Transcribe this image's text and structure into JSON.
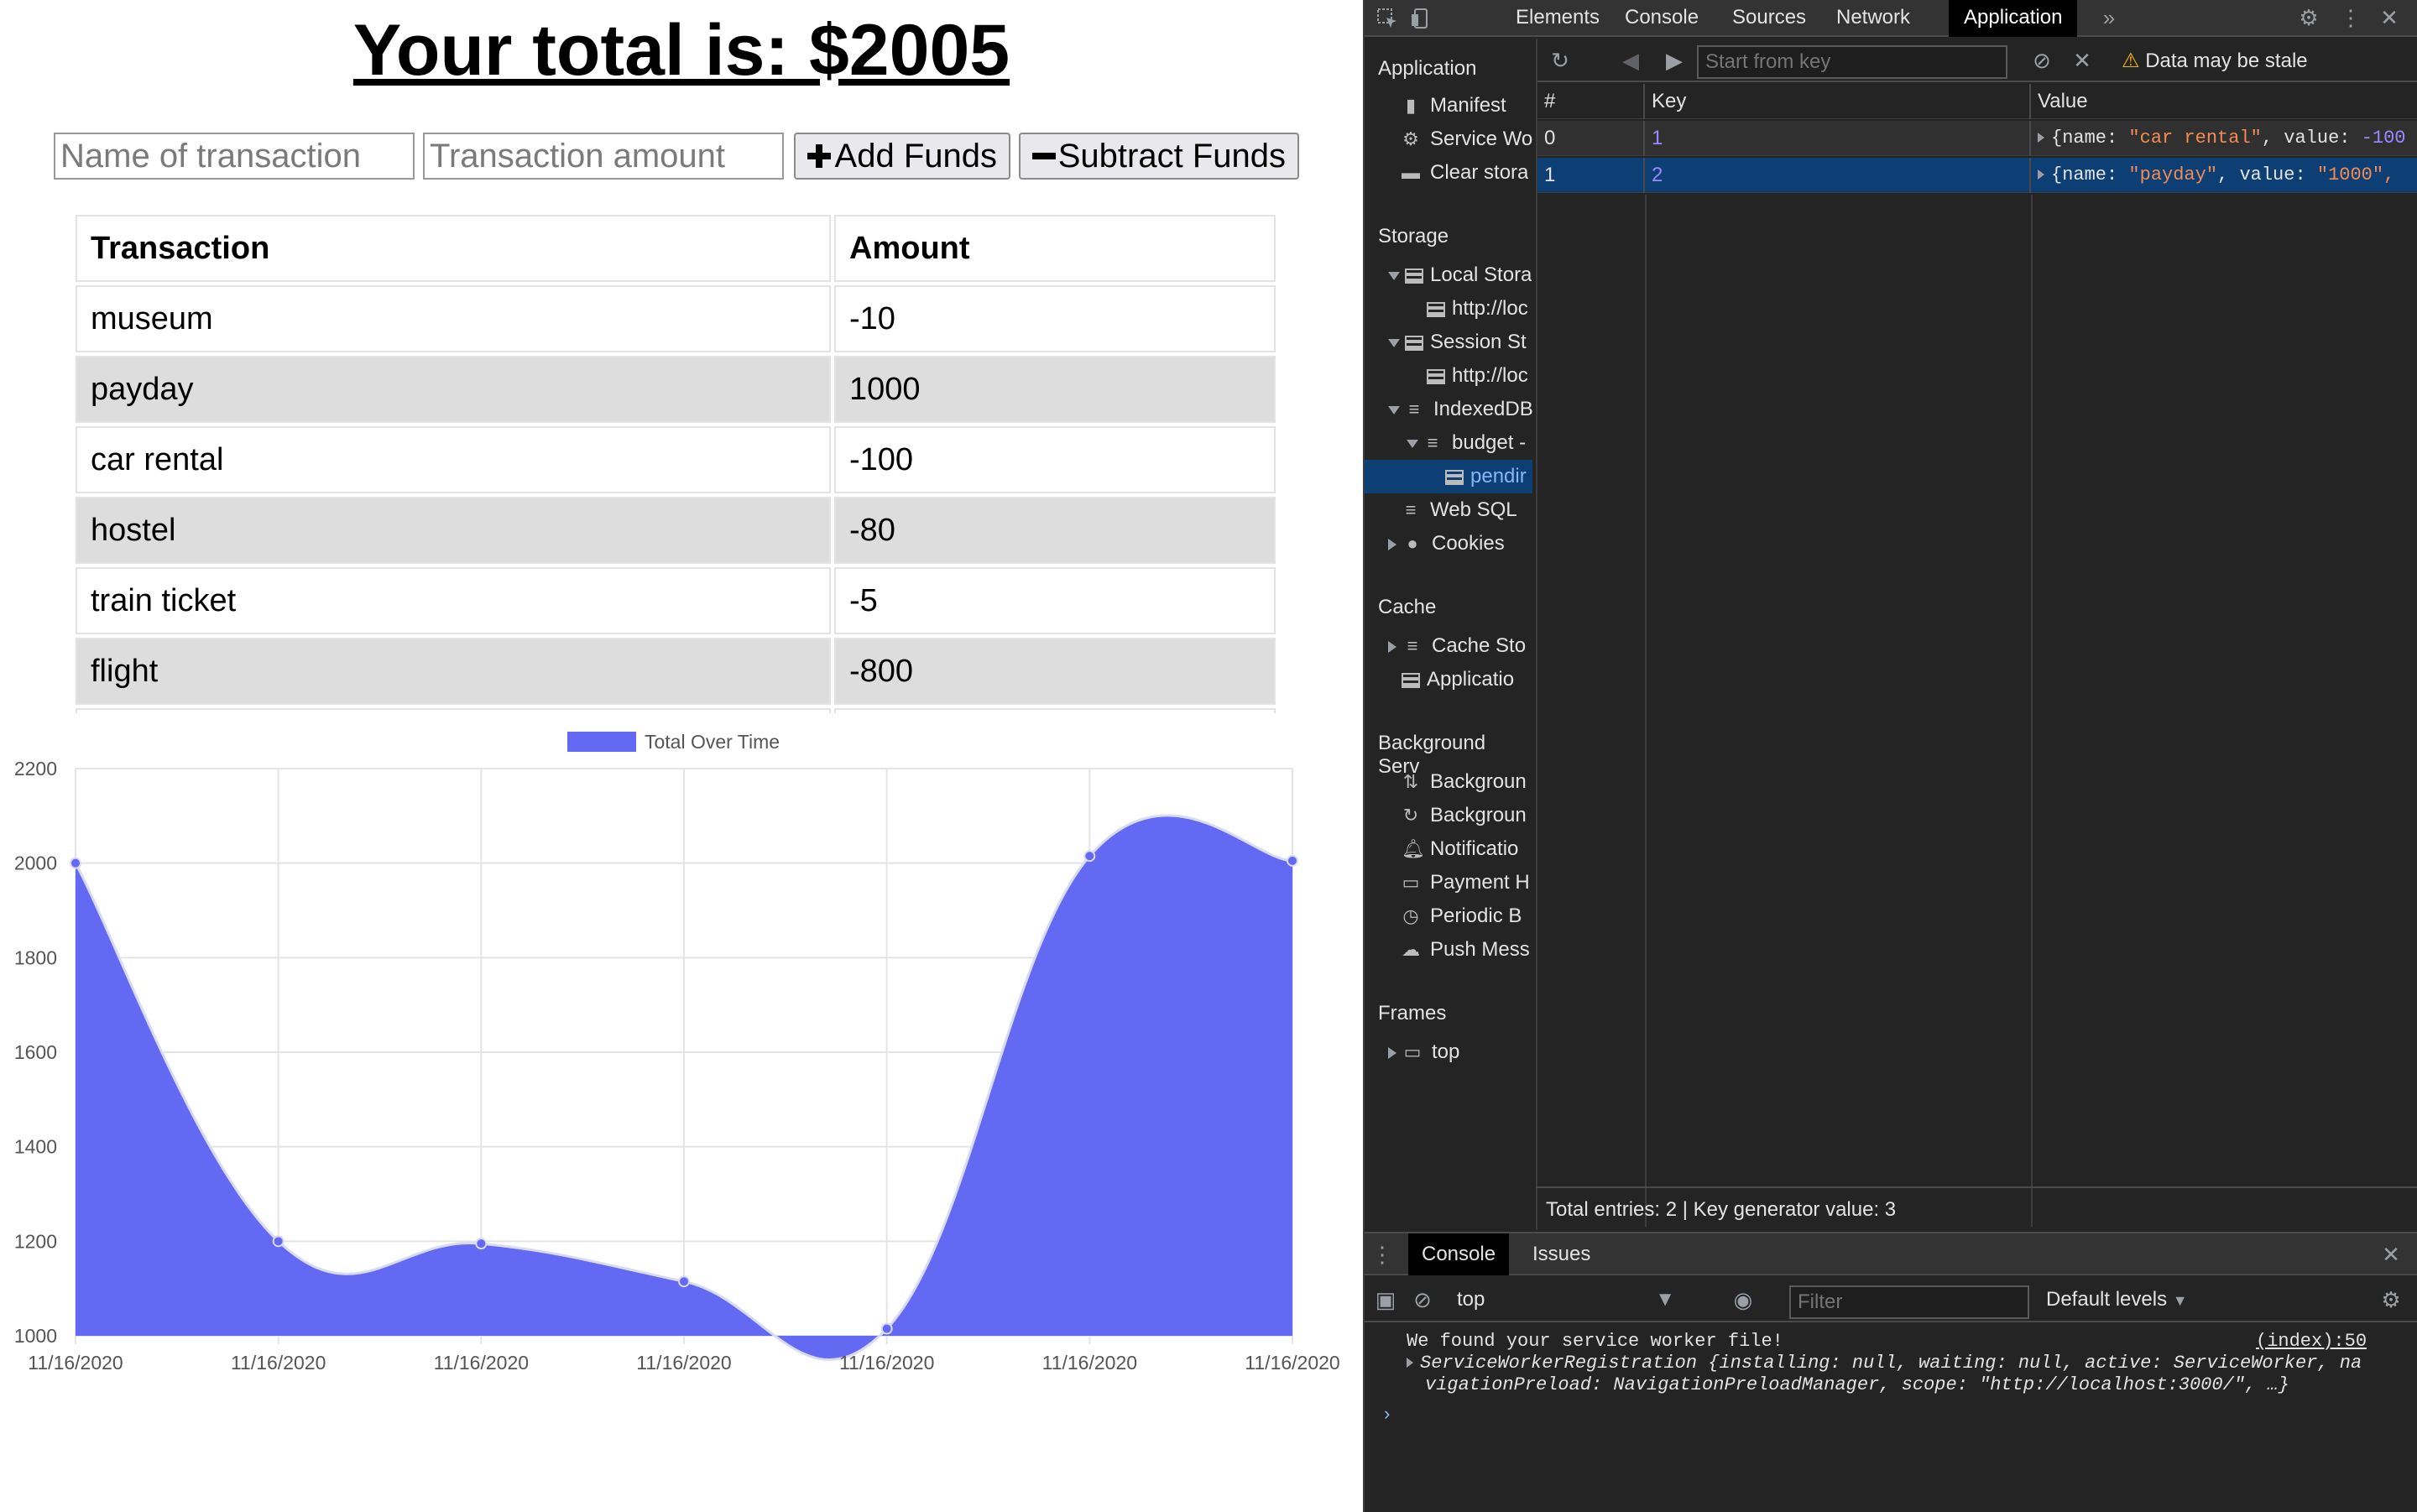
{
  "app": {
    "total_text": "Your total is: $2005",
    "name_placeholder": "Name of transaction",
    "amount_placeholder": "Transaction amount",
    "add_label": "Add Funds",
    "subtract_label": "Subtract Funds",
    "table_headers": [
      "Transaction",
      "Amount"
    ],
    "transactions": [
      {
        "name": "museum",
        "amount": "-10"
      },
      {
        "name": "payday",
        "amount": "1000"
      },
      {
        "name": "car rental",
        "amount": "-100"
      },
      {
        "name": "hostel",
        "amount": "-80"
      },
      {
        "name": "train ticket",
        "amount": "-5"
      },
      {
        "name": "flight",
        "amount": "-800"
      }
    ]
  },
  "chart_data": {
    "type": "area",
    "legend": "Total Over Time",
    "legend_placement": "top-center",
    "categories": [
      "11/16/2020",
      "11/16/2020",
      "11/16/2020",
      "11/16/2020",
      "11/16/2020",
      "11/16/2020",
      "11/16/2020"
    ],
    "series": [
      {
        "name": "Total Over Time",
        "values": [
          2000,
          1200,
          1195,
          1115,
          1015,
          2015,
          2005
        ]
      }
    ],
    "yticks": [
      1000,
      1200,
      1400,
      1600,
      1800,
      2000,
      2200
    ],
    "ylim": [
      1000,
      2200
    ],
    "grid": true,
    "color": "#6369f2"
  },
  "devtools": {
    "tabs": [
      "Elements",
      "Console",
      "Sources",
      "Network",
      "Application"
    ],
    "active_tab": "Application",
    "sidebar": {
      "application_header": "Application",
      "application_items": [
        "Manifest",
        "Service Wo",
        "Clear stora"
      ],
      "storage_header": "Storage",
      "storage_items": [
        "Local Stora",
        "http://loc",
        "Session St",
        "http://loc",
        "IndexedDB",
        "budget -",
        "pendir",
        "Web SQL",
        "Cookies"
      ],
      "cache_header": "Cache",
      "cache_items": [
        "Cache Sto",
        "Applicatio"
      ],
      "background_header": "Background Serv",
      "background_items": [
        "Backgroun",
        "Backgroun",
        "Notificatio",
        "Payment H",
        "Periodic B",
        "Push Mess"
      ],
      "frames_header": "Frames",
      "frames_items": [
        "top"
      ]
    },
    "start_from_key": "Start from key",
    "stale_text": "Data may be stale",
    "idb_headers": [
      "#",
      "Key",
      "Value"
    ],
    "idb_rows": [
      {
        "index": "0",
        "key": "1",
        "value_pre": "{name: ",
        "value_name": "\"car rental\"",
        "value_mid": ", value: ",
        "value_val": "-100"
      },
      {
        "index": "1",
        "key": "2",
        "value_pre": "{name: ",
        "value_name": "\"payday\"",
        "value_mid": ", value: ",
        "value_val": "\"1000\","
      }
    ],
    "status": "Total entries: 2 | Key generator value: 3",
    "drawer_tabs": [
      "Console",
      "Issues"
    ],
    "context": "top",
    "filter_placeholder": "Filter",
    "levels": "Default levels",
    "log_line1": "We found your service worker file!",
    "log_source": "(index):50",
    "log_line2": "ServiceWorkerRegistration {installing: null, waiting: null, active: ServiceWorker, na",
    "log_line3": "vigationPreload: NavigationPreloadManager, scope: \"http://localhost:3000/\", …}"
  }
}
